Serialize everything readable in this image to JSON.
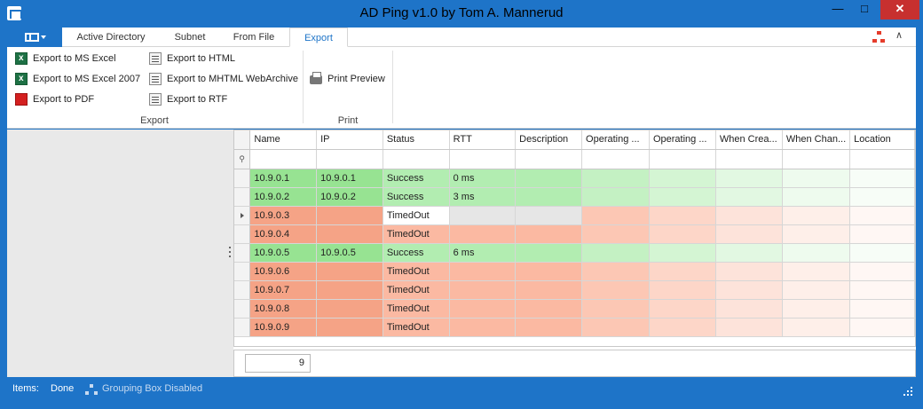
{
  "window": {
    "title": "AD Ping v1.0 by Tom A. Mannerud",
    "minimize": "—",
    "maximize": "□",
    "close": "✕"
  },
  "ribbon": {
    "tabs": [
      "Active Directory",
      "Subnet",
      "From File",
      "Export"
    ],
    "active_tab": "Export",
    "collapse": "∧",
    "groups": {
      "export": {
        "label": "Export",
        "buttons": [
          "Export to MS Excel",
          "Export to MS Excel 2007",
          "Export to PDF",
          "Export to HTML",
          "Export to MHTML WebArchive",
          "Export to RTF"
        ]
      },
      "print": {
        "label": "Print",
        "buttons": [
          "Print Preview"
        ]
      }
    }
  },
  "grid": {
    "columns": [
      "Name",
      "IP",
      "Status",
      "RTT",
      "Description",
      "Operating ...",
      "Operating ...",
      "When Crea...",
      "When Chan...",
      "Location"
    ],
    "rows": [
      {
        "name": "10.9.0.1",
        "ip": "10.9.0.1",
        "status": "Success",
        "rtt": "0 ms"
      },
      {
        "name": "10.9.0.2",
        "ip": "10.9.0.2",
        "status": "Success",
        "rtt": "3 ms"
      },
      {
        "name": "10.9.0.3",
        "ip": "",
        "status": "TimedOut",
        "rtt": ""
      },
      {
        "name": "10.9.0.4",
        "ip": "",
        "status": "TimedOut",
        "rtt": ""
      },
      {
        "name": "10.9.0.5",
        "ip": "10.9.0.5",
        "status": "Success",
        "rtt": "6 ms"
      },
      {
        "name": "10.9.0.6",
        "ip": "",
        "status": "TimedOut",
        "rtt": ""
      },
      {
        "name": "10.9.0.7",
        "ip": "",
        "status": "TimedOut",
        "rtt": ""
      },
      {
        "name": "10.9.0.8",
        "ip": "",
        "status": "TimedOut",
        "rtt": ""
      },
      {
        "name": "10.9.0.9",
        "ip": "",
        "status": "TimedOut",
        "rtt": ""
      }
    ],
    "focused_row": 2,
    "row_count": "9"
  },
  "statusbar": {
    "items_label": "Items:",
    "items_value": "Done",
    "grouping": "Grouping Box Disabled"
  },
  "colors": {
    "accent": "#1e74c8",
    "success": "#b2edb1",
    "timedout": "#fbb9a2"
  },
  "icons": [
    "app-icon",
    "app-menu-icon",
    "network-icon",
    "excel-icon",
    "pdf-icon",
    "html-icon",
    "mhtml-icon",
    "rtf-icon",
    "printer-icon",
    "filter-pin-icon",
    "row-indicator-icon",
    "grouping-icon",
    "resize-grip-icon"
  ]
}
